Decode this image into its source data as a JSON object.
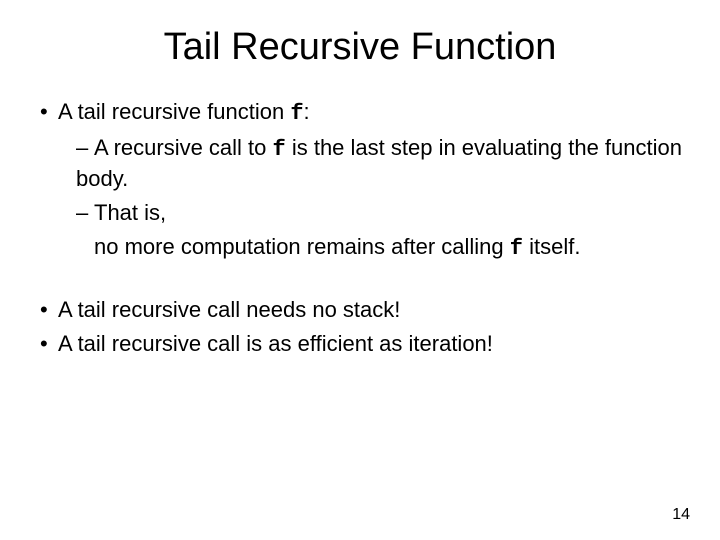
{
  "title": "Tail Recursive Function",
  "fsym": "f",
  "l1a_pre": "A tail recursive function ",
  "l1a_post": ":",
  "l2a_pre": "A recursive call to ",
  "l2a_post": " is the last step in evaluating the function body.",
  "l2b_pre": "That is,",
  "l2b_cont_pre": "no more computation remains after calling ",
  "l2b_cont_post": " itself.",
  "l1b": "A tail recursive call needs no stack!",
  "l1c": "A tail recursive call is as efficient as iteration!",
  "page": "14",
  "bul1": "•",
  "bul2": "–"
}
